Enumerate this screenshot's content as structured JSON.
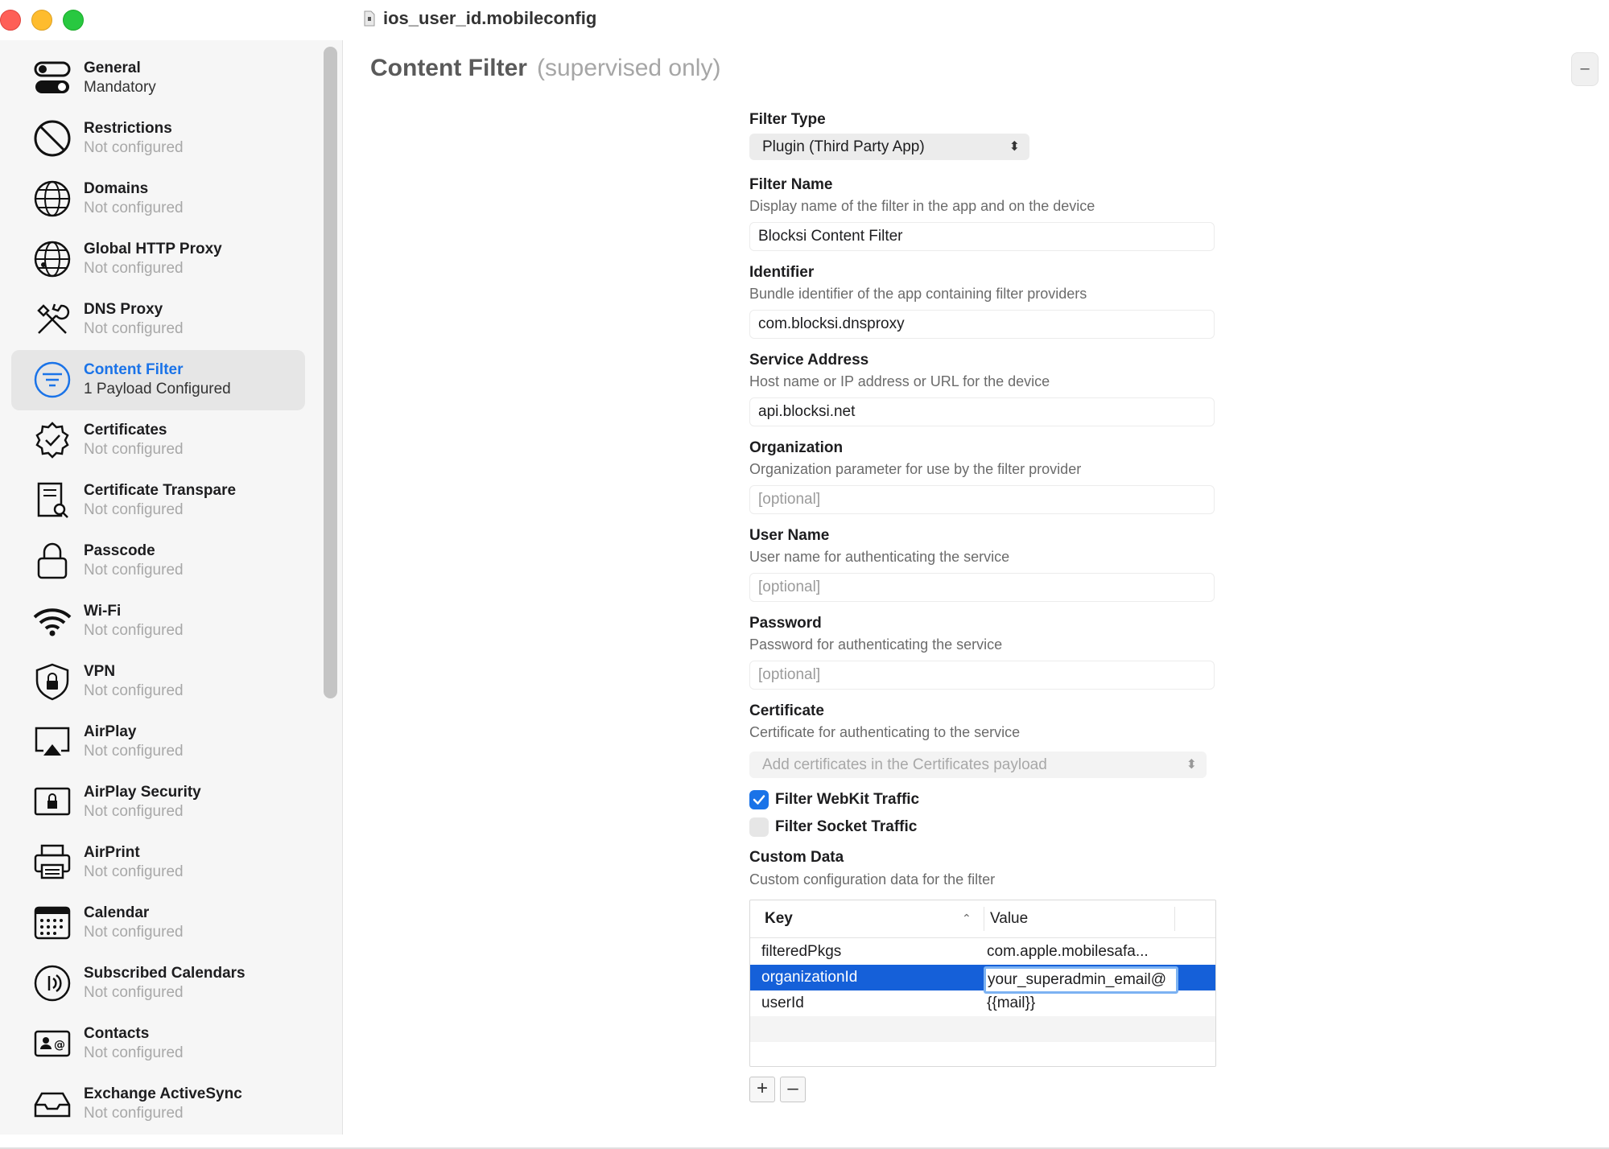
{
  "window": {
    "title": "ios_user_id.mobileconfig"
  },
  "sidebar": {
    "items": [
      {
        "name": "General",
        "status": "Mandatory",
        "icon": "toggle-icon"
      },
      {
        "name": "Restrictions",
        "status": "Not configured",
        "icon": "prohibited-icon"
      },
      {
        "name": "Domains",
        "status": "Not configured",
        "icon": "globe-icon"
      },
      {
        "name": "Global HTTP Proxy",
        "status": "Not configured",
        "icon": "globe-network-icon"
      },
      {
        "name": "DNS Proxy",
        "status": "Not configured",
        "icon": "tools-icon"
      },
      {
        "name": "Content Filter",
        "status": "1 Payload Configured",
        "icon": "filter-icon"
      },
      {
        "name": "Certificates",
        "status": "Not configured",
        "icon": "certificate-badge-icon"
      },
      {
        "name": "Certificate Transpare",
        "status": "Not configured",
        "icon": "document-search-icon"
      },
      {
        "name": "Passcode",
        "status": "Not configured",
        "icon": "lock-icon"
      },
      {
        "name": "Wi-Fi",
        "status": "Not configured",
        "icon": "wifi-icon"
      },
      {
        "name": "VPN",
        "status": "Not configured",
        "icon": "shield-lock-icon"
      },
      {
        "name": "AirPlay",
        "status": "Not configured",
        "icon": "airplay-icon"
      },
      {
        "name": "AirPlay Security",
        "status": "Not configured",
        "icon": "airplay-lock-icon"
      },
      {
        "name": "AirPrint",
        "status": "Not configured",
        "icon": "printer-icon"
      },
      {
        "name": "Calendar",
        "status": "Not configured",
        "icon": "calendar-icon"
      },
      {
        "name": "Subscribed Calendars",
        "status": "Not configured",
        "icon": "broadcast-icon"
      },
      {
        "name": "Contacts",
        "status": "Not configured",
        "icon": "contact-card-icon"
      },
      {
        "name": "Exchange ActiveSync",
        "status": "Not configured",
        "icon": "inbox-icon"
      }
    ]
  },
  "content": {
    "title": "Content Filter",
    "subtitle": "(supervised only)",
    "collapse_label": "–",
    "filter_type": {
      "label": "Filter Type",
      "value": "Plugin (Third Party App)"
    },
    "filter_name": {
      "label": "Filter Name",
      "description": "Display name of the filter in the app and on the device",
      "value": "Blocksi Content Filter"
    },
    "identifier": {
      "label": "Identifier",
      "description": "Bundle identifier of the app containing filter providers",
      "value": "com.blocksi.dnsproxy"
    },
    "service_address": {
      "label": "Service Address",
      "description": "Host name or IP address or URL for the device",
      "value": "api.blocksi.net"
    },
    "organization": {
      "label": "Organization",
      "description": "Organization parameter for use by the filter provider",
      "placeholder": "[optional]"
    },
    "user_name": {
      "label": "User Name",
      "description": "User name for authenticating the service",
      "placeholder": "[optional]"
    },
    "password": {
      "label": "Password",
      "description": "Password for authenticating the service",
      "placeholder": "[optional]"
    },
    "certificate": {
      "label": "Certificate",
      "description": "Certificate for authenticating to the service",
      "value": "Add certificates in the Certificates payload"
    },
    "filter_webkit": {
      "label": "Filter WebKit Traffic",
      "checked": true
    },
    "filter_socket": {
      "label": "Filter Socket Traffic",
      "checked": false
    },
    "custom_data": {
      "label": "Custom Data",
      "description": "Custom configuration data for the filter",
      "columns": [
        "Key",
        "Value"
      ],
      "rows": [
        {
          "key": "filteredPkgs",
          "value": "com.apple.mobilesafa..."
        },
        {
          "key": "organizationId",
          "value": "your_superadmin_email@"
        },
        {
          "key": "userId",
          "value": "{{mail}}"
        }
      ],
      "add_label": "+",
      "remove_label": "–"
    }
  },
  "colors": {
    "accent": "#1a73e8",
    "selection": "#1560d9",
    "close": "#fe5f57",
    "minimize": "#febc2e",
    "zoom": "#28c840"
  }
}
